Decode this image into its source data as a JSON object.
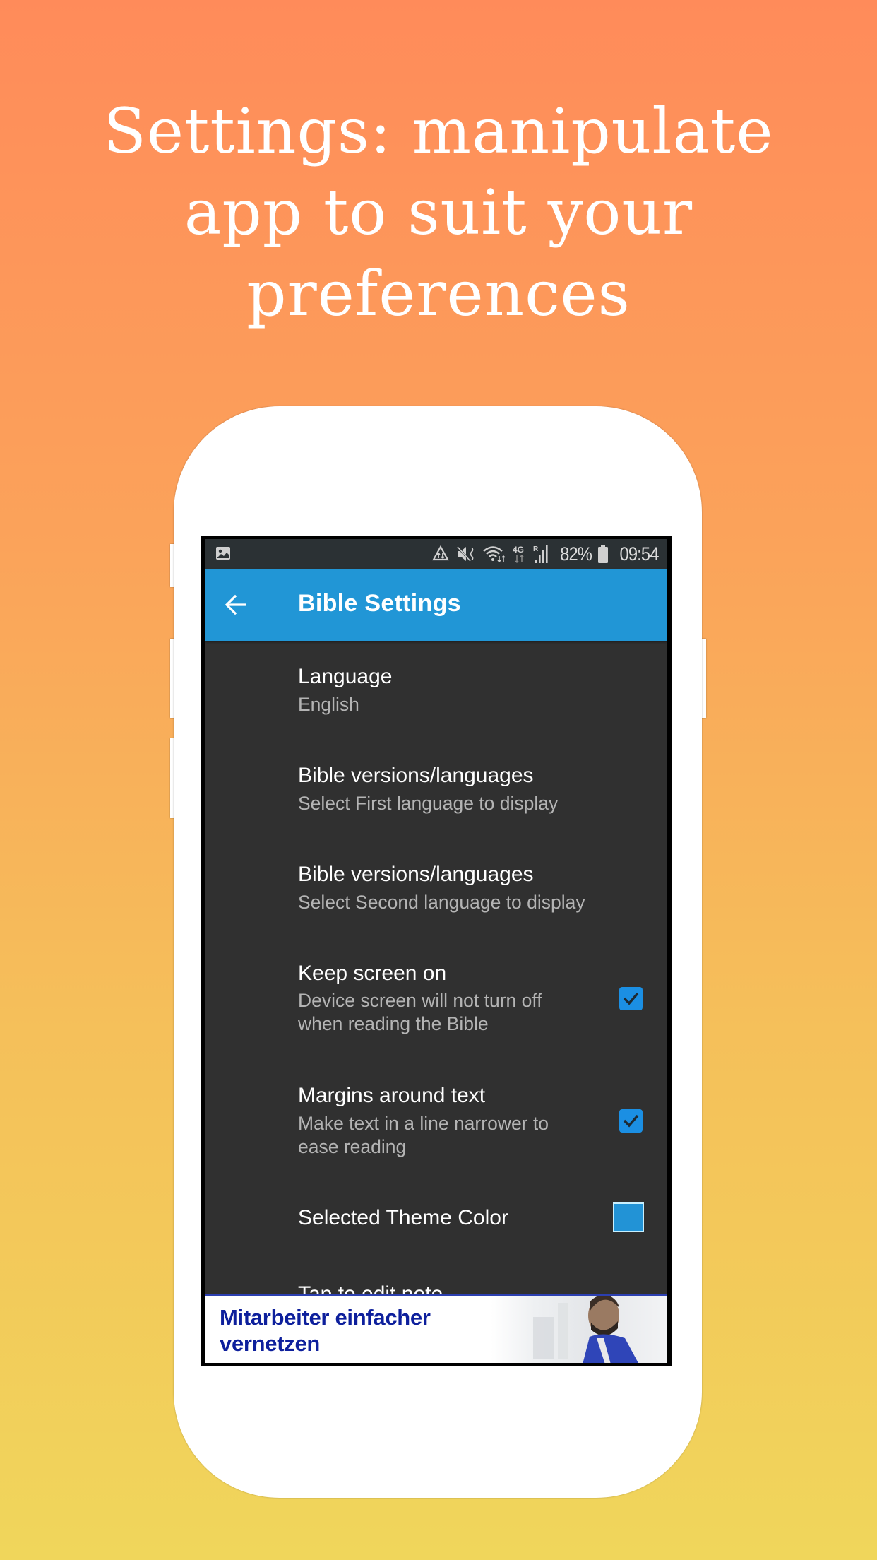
{
  "headline": {
    "lines": [
      "Settings: manipulate",
      "app to suit your",
      "preferences"
    ]
  },
  "colors": {
    "accent": "#2196D6",
    "checkbox": "#1B8FE3",
    "background_top": "#FF8B5A",
    "background_bottom": "#F0D65B",
    "ad_text": "#0D1F9C"
  },
  "status_bar": {
    "left_icon": "image-notification-icon",
    "icons": [
      "data-saver-icon",
      "vibrate-mute-icon",
      "wifi-icon",
      "4g-icon",
      "signal-roaming-icon"
    ],
    "network_label": "4G",
    "roaming_label": "R",
    "battery_percent": "82%",
    "battery_icon": "battery-icon",
    "time": "09:54"
  },
  "app_bar": {
    "back_icon": "arrow-left-icon",
    "title": "Bible Settings"
  },
  "preferences": [
    {
      "title": "Language",
      "summary": [
        "English"
      ],
      "widget": "none"
    },
    {
      "title": "Bible versions/languages",
      "summary": [
        "Select First language to display"
      ],
      "widget": "none"
    },
    {
      "title": "Bible versions/languages",
      "summary": [
        "Select Second language to display"
      ],
      "widget": "none"
    },
    {
      "title": "Keep screen on",
      "summary": [
        "Device screen will not turn off",
        "when reading the Bible"
      ],
      "widget": "checkbox",
      "checked": true
    },
    {
      "title": "Margins around text",
      "summary": [
        "Make text in a line narrower to",
        "ease reading"
      ],
      "widget": "checkbox",
      "checked": true
    },
    {
      "title": "Selected Theme Color",
      "summary": [],
      "widget": "color-swatch",
      "color": "#2293D6"
    },
    {
      "title": "Tap to edit note",
      "summary": [],
      "widget": "none"
    }
  ],
  "ad_banner": {
    "lines": [
      "Mitarbeiter einfacher",
      "vernetzen"
    ],
    "image": "person-photo"
  }
}
